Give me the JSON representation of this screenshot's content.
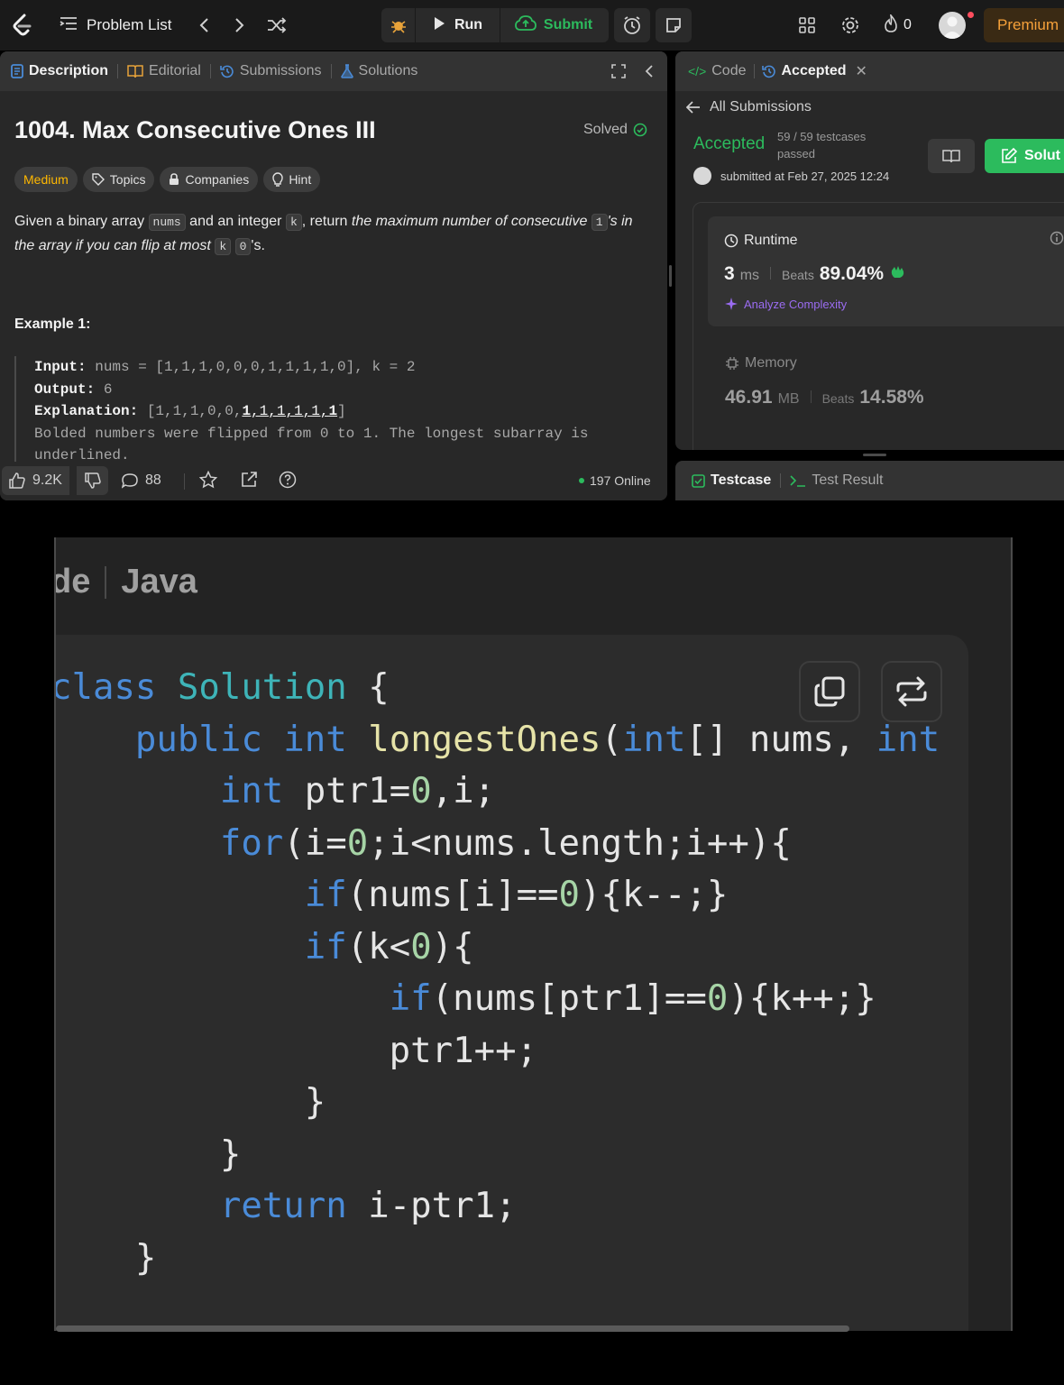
{
  "topbar": {
    "problem_list": "Problem List",
    "run": "Run",
    "submit": "Submit",
    "streak_count": "0",
    "premium": "Premium"
  },
  "left_panel": {
    "tabs": [
      "Description",
      "Editorial",
      "Submissions",
      "Solutions"
    ],
    "title": "1004. Max Consecutive Ones III",
    "solved": "Solved",
    "chips": [
      "Medium",
      "Topics",
      "Companies",
      "Hint"
    ],
    "description": {
      "p1": "Given a binary array ",
      "code_nums": "nums",
      "p2": " and an integer ",
      "code_k": "k",
      "p3": ", return ",
      "italic1": "the maximum number of consecutive ",
      "code_1": "1",
      "italic2": "'s in the array if you can flip at most ",
      "code_k2": "k",
      "code_0": "0",
      "italic3": "'s."
    },
    "example_title": "Example 1:",
    "example": {
      "input_label": "Input:",
      "input_value": " nums = [1,1,1,0,0,0,1,1,1,1,0], k = 2",
      "output_label": "Output:",
      "output_value": " 6",
      "explanation_label": "Explanation:",
      "explanation_prefix": " [1,1,1,0,0,",
      "explanation_flipped1": "1",
      "explanation_mid": ",1,1,1,1,",
      "explanation_flipped2": "1",
      "explanation_suffix": "]",
      "note_line1": "Bolded numbers were flipped from 0 to 1. The longest subarray is",
      "note_line2": "underlined."
    },
    "footer": {
      "likes": "9.2K",
      "comments": "88",
      "online": "197 Online"
    }
  },
  "right_panel": {
    "tabs": [
      "Code",
      "Accepted"
    ],
    "all_submissions": "All Submissions",
    "status": "Accepted",
    "testcases": "59 / 59 testcases passed",
    "submitted_at": "submitted at Feb 27, 2025 12:24",
    "solution_button": "Solut",
    "runtime": {
      "label": "Runtime",
      "value": "3",
      "unit": "ms",
      "beats_label": "Beats",
      "beats_value": "89.04%",
      "analyze": "Analyze Complexity"
    },
    "memory": {
      "label": "Memory",
      "value": "46.91",
      "unit": "MB",
      "beats_label": "Beats",
      "beats_value": "14.58%"
    },
    "test_tabs": [
      "Testcase",
      "Test Result"
    ]
  },
  "code_view": {
    "header_left": "de",
    "header_lang": "Java",
    "lines": [
      "class Solution {",
      "    public int longestOnes(int[] nums, int",
      "        int ptr1=0,i;",
      "        for(i=0;i<nums.length;i++){",
      "            if(nums[i]==0){k--;}",
      "            if(k<0){",
      "                if(nums[ptr1]==0){k++;}",
      "                ptr1++;",
      "            }",
      "        }",
      "        return i-ptr1;",
      "    }"
    ]
  },
  "colors": {
    "accent_green": "#2cbb5d",
    "medium_yellow": "#ffb800",
    "premium_orange": "#f6a13a",
    "keyword_blue": "#4a8bd8",
    "type_teal": "#3eb4b8",
    "function_yellow": "#e6e3a8",
    "number_green": "#a6d4a6"
  }
}
